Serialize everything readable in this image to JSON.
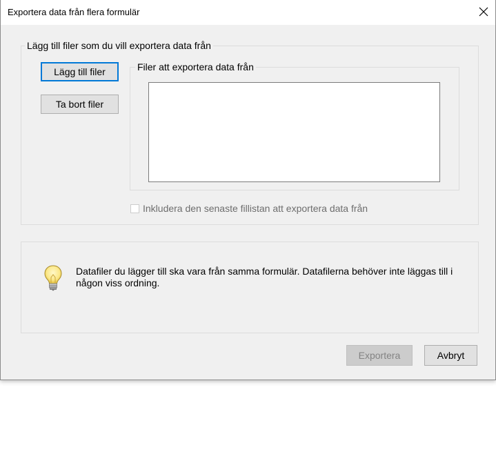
{
  "window": {
    "title": "Exportera data från flera formulär"
  },
  "add_files_group": {
    "label": "Lägg till filer som du vill exportera data från",
    "add_button_label": "Lägg till filer",
    "remove_button_label": "Ta bort filer",
    "files_group_label": "Filer att exportera data från",
    "files": []
  },
  "include_recent": {
    "label": "Inkludera den senaste fillistan att exportera data från",
    "checked": false,
    "enabled": false
  },
  "info": {
    "icon": "lightbulb-icon",
    "text": "Datafiler du lägger till ska vara från samma formulär. Datafilerna behöver inte läggas till i någon viss ordning."
  },
  "footer": {
    "export_label": "Exportera",
    "cancel_label": "Avbryt"
  }
}
